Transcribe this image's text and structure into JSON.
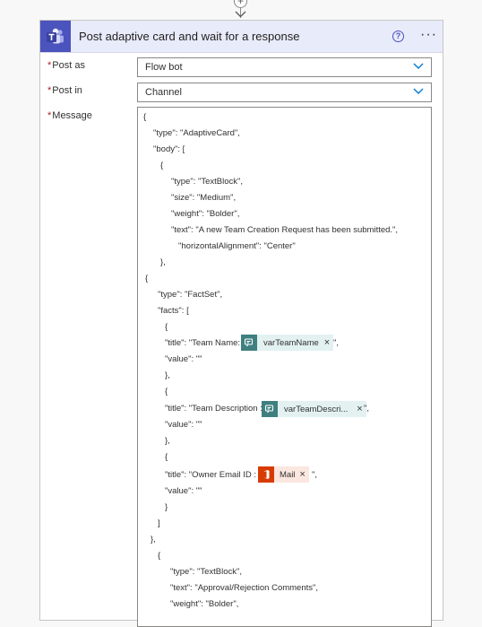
{
  "step": {
    "add_glyph": "+",
    "title": "Post adaptive card and wait for a response",
    "help_glyph": "?",
    "more_glyph": "···"
  },
  "fields": {
    "post_as": {
      "required": "*",
      "label": "Post as",
      "value": "Flow bot"
    },
    "post_in": {
      "required": "*",
      "label": "Post in",
      "value": "Channel"
    },
    "message": {
      "required": "*",
      "label": "Message"
    }
  },
  "message_lines": {
    "l1": "{",
    "l2": "\"type\": \"AdaptiveCard\",",
    "l3": "\"body\": [",
    "l4": "{",
    "l5": "\"type\": \"TextBlock\",",
    "l6": "\"size\": \"Medium\",",
    "l7": "\"weight\": \"Bolder\",",
    "l8": "\"text\": \"A new Team Creation Request has been submitted.\",",
    "l9": "\"horizontalAlignment\": \"Center\"",
    "l10": "},",
    "l11": "{",
    "l12": "\"type\": \"FactSet\",",
    "l13": "\"facts\": [",
    "l14": "{",
    "l15a": "\"title\": \"Team Name:",
    "l15b": "\",",
    "l16": "\"value\": \"\"",
    "l17": "},",
    "l18": "{",
    "l19a": "\"title\": \"Team Description :",
    "l19b": "\",",
    "l20": "\"value\": \"\"",
    "l21": "},",
    "l22": "{",
    "l23a": "\"title\": \"Owner Email ID :",
    "l23b": "\",",
    "l24": "\"value\": \"\"",
    "l25": "}",
    "l26": "]",
    "l27": "},",
    "l28": "{",
    "l29": "\"type\": \"TextBlock\",",
    "l30": "\"text\": \"Approval/Rejection Comments\",",
    "l31": "\"weight\": \"Bolder\","
  },
  "tokens": {
    "team_name": {
      "label": "varTeamName",
      "icon": "variable-icon",
      "remove": "×"
    },
    "team_desc": {
      "label": "varTeamDescri...",
      "icon": "variable-icon",
      "remove": "×"
    },
    "mail": {
      "label": "Mail",
      "icon": "office-icon",
      "remove": "×"
    }
  },
  "colors": {
    "header_bg": "#e8ebfa",
    "teams_purple": "#4b53bc",
    "variable_teal": "#3f7f7f",
    "office_orange": "#d83b01",
    "required_red": "#a4262c"
  }
}
